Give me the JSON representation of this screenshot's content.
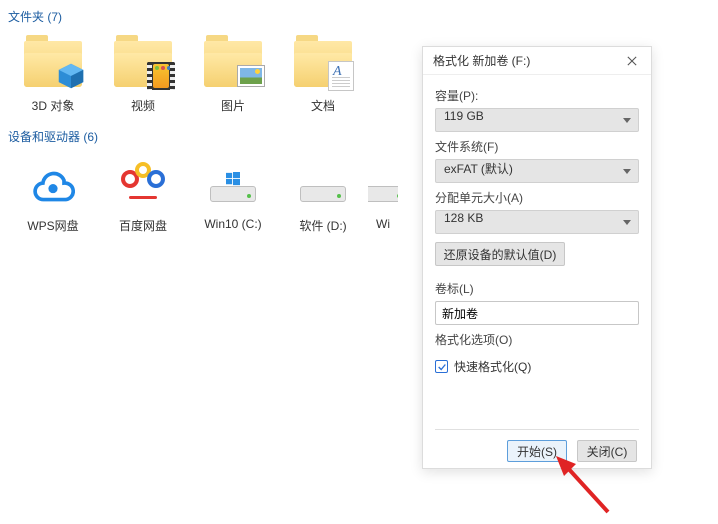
{
  "folders_section": {
    "title": "文件夹 (7)",
    "items": [
      {
        "label": "3D 对象",
        "icon": "3d-cube"
      },
      {
        "label": "视频",
        "icon": "video"
      },
      {
        "label": "图片",
        "icon": "picture"
      },
      {
        "label": "文档",
        "icon": "document"
      }
    ]
  },
  "drives_section": {
    "title": "设备和驱动器 (6)",
    "items": [
      {
        "label": "WPS网盘",
        "icon": "wps-cloud"
      },
      {
        "label": "百度网盘",
        "icon": "baidu"
      },
      {
        "label": "Win10 (C:)",
        "icon": "windrive"
      },
      {
        "label": "软件 (D:)",
        "icon": "drive"
      },
      {
        "label": "Wi",
        "icon": "drive",
        "cut": true
      }
    ]
  },
  "format_dialog": {
    "title": "格式化 新加卷 (F:)",
    "capacity_label": "容量(P):",
    "capacity_value": "119 GB",
    "filesystem_label": "文件系统(F)",
    "filesystem_value": "exFAT (默认)",
    "alloc_label": "分配单元大小(A)",
    "alloc_value": "128 KB",
    "restore_btn": "还原设备的默认值(D)",
    "volume_label": "卷标(L)",
    "volume_value": "新加卷",
    "options_label": "格式化选项(O)",
    "quick_format_label": "快速格式化(Q)",
    "quick_format_checked": true,
    "start_btn": "开始(S)",
    "close_btn": "关闭(C)"
  }
}
